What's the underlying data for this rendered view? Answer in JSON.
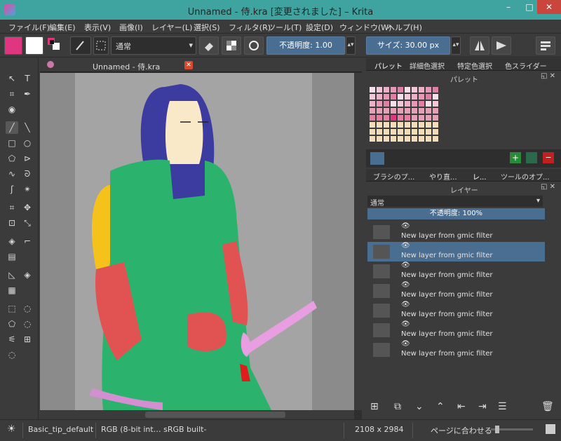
{
  "window": {
    "title": "Unnamed - 侍.kra [変更されました] – Krita",
    "minimize": "–",
    "maximize": "□",
    "close": "✕"
  },
  "menu": [
    "ファイル(F)",
    "編集(E)",
    "表示(V)",
    "画像(I)",
    "レイヤー(L)",
    "選択(S)",
    "フィルタ(R)",
    "ツール(T)",
    "設定(D)",
    "ウィンドウ(W)",
    "ヘルプ(H)"
  ],
  "toolbar": {
    "blend_mode": "通常",
    "opacity_label": "不透明度:  1.00",
    "size_label": "サイズ:  30.00 px"
  },
  "document_tab": {
    "label": "Unnamed - 侍.kra",
    "close": "✕"
  },
  "docker_tabs_top": [
    "パレット",
    "詳細色選択",
    "特定色選択",
    "色スライダー"
  ],
  "palette": {
    "title": "パレット"
  },
  "docker_tabs_mid": [
    "ブラシのプ...",
    "やり直...",
    "レ...",
    "ツールのオプ..."
  ],
  "layers": {
    "title": "レイヤー",
    "blend_mode": "通常",
    "opacity": "不透明度:  100%",
    "items": [
      {
        "name": "New layer from gmic filter",
        "selected": false
      },
      {
        "name": "New layer from gmic filter",
        "selected": true
      },
      {
        "name": "New layer from gmic filter",
        "selected": false
      },
      {
        "name": "New layer from gmic filter",
        "selected": false
      },
      {
        "name": "New layer from gmic filter",
        "selected": false
      },
      {
        "name": "New layer from gmic filter",
        "selected": false
      },
      {
        "name": "New layer from gmic filter",
        "selected": false
      }
    ]
  },
  "status": {
    "brush": "Basic_tip_default",
    "color": "RGB (8-bit int… sRGB built-",
    "size": "2108 x 2984",
    "zoom": "ページに合わせる"
  },
  "colors": {
    "accent": "#4a6e91",
    "title_bg": "#3fa4a0",
    "fg_color": "#e0357f",
    "palette_pink": "#e0357f"
  }
}
